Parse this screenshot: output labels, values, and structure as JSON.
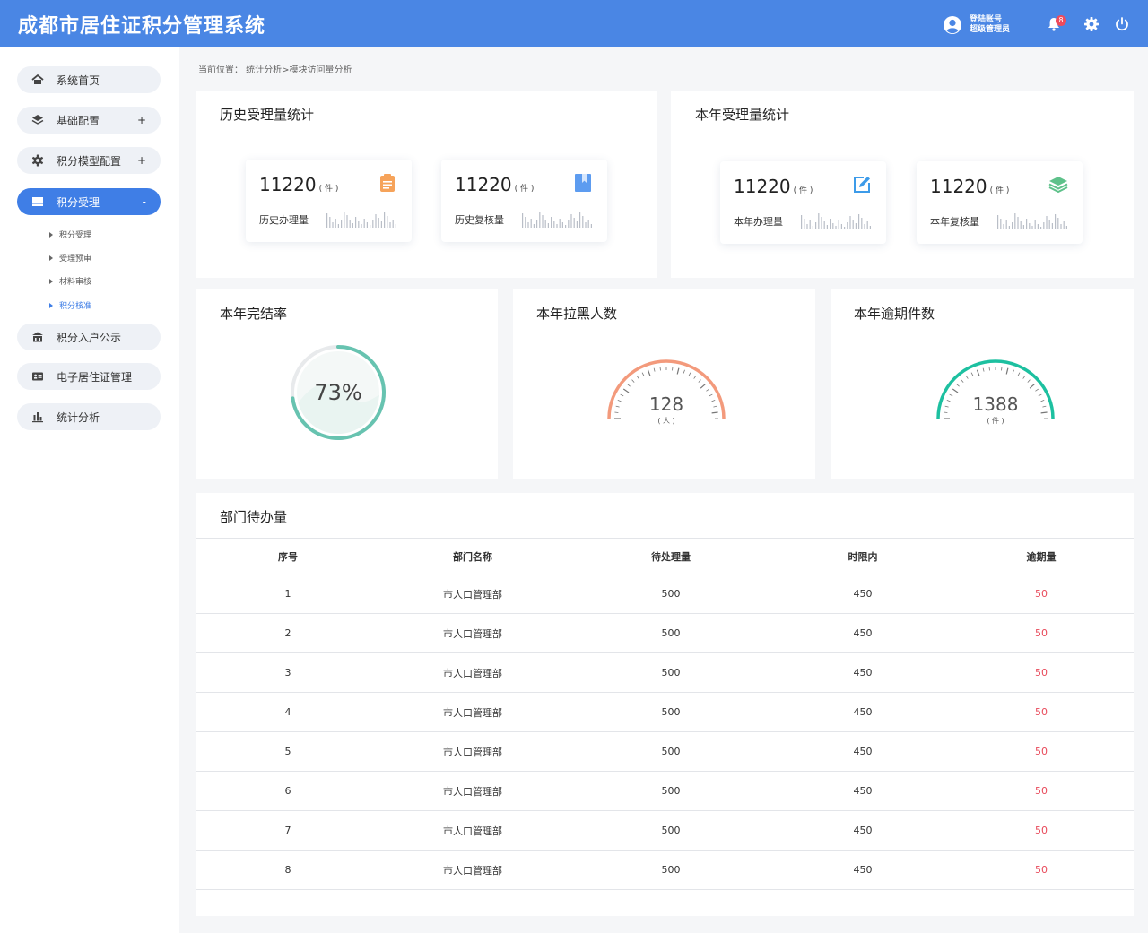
{
  "header": {
    "title": "成都市居住证积分管理系统",
    "user_line1": "登陆账号",
    "user_line2": "超级管理员",
    "notification_count": "8"
  },
  "sidebar": {
    "items": [
      {
        "label": "系统首页",
        "icon": "home-icon",
        "toggle": ""
      },
      {
        "label": "基础配置",
        "icon": "layers-icon",
        "toggle": "+"
      },
      {
        "label": "积分模型配置",
        "icon": "gear-icon",
        "toggle": "+"
      },
      {
        "label": "积分受理",
        "icon": "inbox-icon",
        "toggle": "-"
      },
      {
        "label": "积分入户公示",
        "icon": "building-icon",
        "toggle": ""
      },
      {
        "label": "电子居住证管理",
        "icon": "id-card-icon",
        "toggle": ""
      },
      {
        "label": "统计分析",
        "icon": "bar-chart-icon",
        "toggle": ""
      }
    ],
    "subitems": [
      "积分受理",
      "受理预审",
      "材料审核",
      "积分核准"
    ]
  },
  "breadcrumb": "当前位置： 统计分析>模块访问量分析",
  "history": {
    "title": "历史受理量统计",
    "cards": [
      {
        "value": "11220",
        "unit": "( 件 )",
        "label": "历史办理量",
        "icon": "clipboard-icon",
        "color": "#f6a35a"
      },
      {
        "value": "11220",
        "unit": "( 件 )",
        "label": "历史复核量",
        "icon": "bookmark-icon",
        "color": "#5d9cf0"
      }
    ]
  },
  "year": {
    "title": "本年受理量统计",
    "cards": [
      {
        "value": "11220",
        "unit": "( 件 )",
        "label": "本年办理量",
        "icon": "edit-icon",
        "color": "#3d9be9"
      },
      {
        "value": "11220",
        "unit": "( 件 )",
        "label": "本年复核量",
        "icon": "layers-icon",
        "color": "#5ec18a"
      }
    ]
  },
  "completion": {
    "title": "本年完结率",
    "value": "73%",
    "fraction": 0.73,
    "color": "#67c3b0"
  },
  "blacklist": {
    "title": "本年拉黑人数",
    "value": "128",
    "unit": "( 人 )",
    "color": "#f39a7c"
  },
  "overdue": {
    "title": "本年逾期件数",
    "value": "1388",
    "unit": "( 件 )",
    "color": "#1dc0a0"
  },
  "dept": {
    "title": "部门待办量",
    "columns": [
      "序号",
      "部门名称",
      "待处理量",
      "时限内",
      "逾期量"
    ],
    "rows": [
      [
        "1",
        "市人口管理部",
        "500",
        "450",
        "50"
      ],
      [
        "2",
        "市人口管理部",
        "500",
        "450",
        "50"
      ],
      [
        "3",
        "市人口管理部",
        "500",
        "450",
        "50"
      ],
      [
        "4",
        "市人口管理部",
        "500",
        "450",
        "50"
      ],
      [
        "5",
        "市人口管理部",
        "500",
        "450",
        "50"
      ],
      [
        "6",
        "市人口管理部",
        "500",
        "450",
        "50"
      ],
      [
        "7",
        "市人口管理部",
        "500",
        "450",
        "50"
      ],
      [
        "8",
        "市人口管理部",
        "500",
        "450",
        "50"
      ]
    ]
  }
}
